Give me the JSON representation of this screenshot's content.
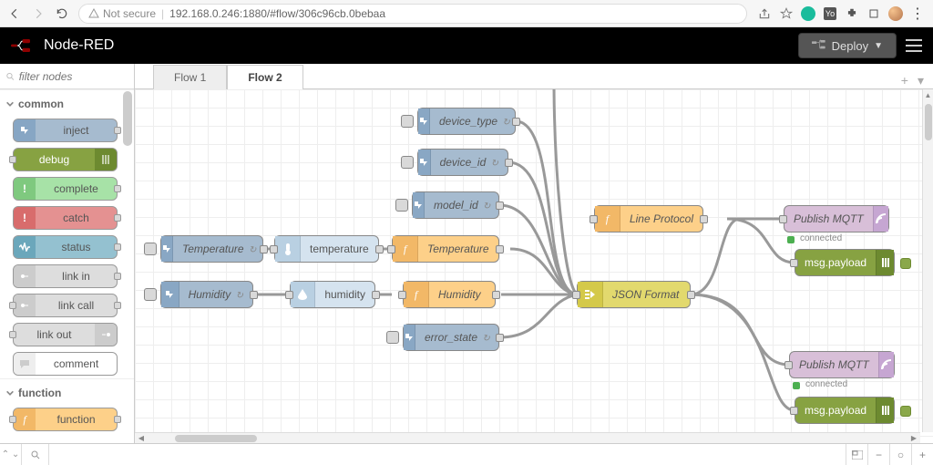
{
  "browser": {
    "security_text": "Not secure",
    "url": "192.168.0.246:1880/#flow/306c96cb.0bebaa"
  },
  "header": {
    "title": "Node-RED",
    "deploy": "Deploy"
  },
  "palette": {
    "filter_placeholder": "filter nodes",
    "cat_common": "common",
    "cat_function": "function",
    "nodes": {
      "inject": "inject",
      "debug": "debug",
      "complete": "complete",
      "catch": "catch",
      "status": "status",
      "linkin": "link in",
      "linkcall": "link call",
      "linkout": "link out",
      "comment": "comment",
      "function": "function"
    }
  },
  "tabs": {
    "flow1": "Flow 1",
    "flow2": "Flow 2"
  },
  "canvas": {
    "device_type": "device_type",
    "device_id": "device_id",
    "model_id": "model_id",
    "temperature_inj": "Temperature",
    "temperature_ch": "temperature",
    "temperature_fn": "Temperature",
    "humidity_inj": "Humidity",
    "humidity_ch": "humidity",
    "humidity_fn": "Humidity",
    "error_state": "error_state",
    "json_format": "JSON Format",
    "line_protocol": "Line Protocol",
    "publish_mqtt": "Publish MQTT",
    "msg_payload": "msg.payload",
    "connected": "connected"
  }
}
